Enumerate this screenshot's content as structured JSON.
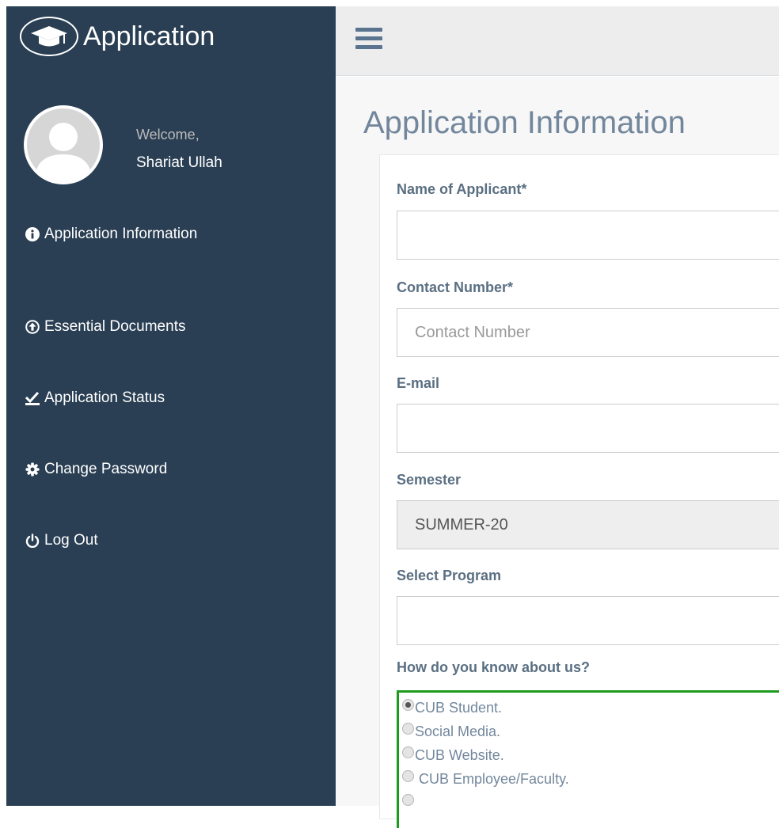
{
  "app": {
    "title": "Application"
  },
  "profile": {
    "welcome": "Welcome,",
    "name": "Shariat Ullah"
  },
  "nav": {
    "items": [
      {
        "label": "Application Information",
        "icon": "info-circle-icon"
      },
      {
        "label": "Essential Documents",
        "icon": "upload-circle-icon"
      },
      {
        "label": "Application Status",
        "icon": "check-icon"
      },
      {
        "label": "Change Password",
        "icon": "gear-icon"
      },
      {
        "label": "Log Out",
        "icon": "power-icon"
      }
    ]
  },
  "page": {
    "title": "Application Information"
  },
  "form": {
    "name": {
      "label": "Name of Applicant*",
      "value": "",
      "placeholder": ""
    },
    "contact": {
      "label": "Contact Number*",
      "value": "",
      "placeholder": "Contact Number"
    },
    "email": {
      "label": "E-mail",
      "value": "",
      "placeholder": ""
    },
    "semester": {
      "label": "Semester",
      "value": "SUMMER-20"
    },
    "program": {
      "label": "Select Program",
      "value": ""
    },
    "source": {
      "label": "How do you know about us?",
      "options": [
        {
          "text": "CUB Student.",
          "checked": true
        },
        {
          "text": "Social Media.",
          "checked": false
        },
        {
          "text": "CUB Website.",
          "checked": false
        },
        {
          "text": " CUB Employee/Faculty.",
          "checked": false
        }
      ]
    }
  },
  "colors": {
    "sidebar_bg": "#2a3f54",
    "topbar_bg": "#ededed",
    "title_text": "#73879c",
    "radio_border": "#1c9b1c"
  }
}
